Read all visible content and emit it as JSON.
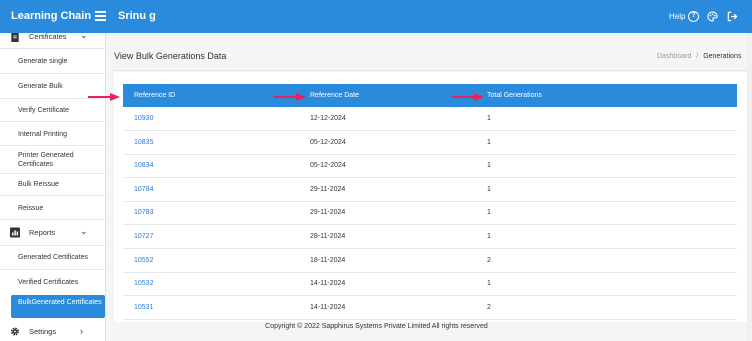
{
  "header": {
    "brand": "Learning Chain",
    "user_name": "Srinu g",
    "help_label": "Help",
    "color": "#2a8bdc"
  },
  "sidebar": {
    "sections": [
      {
        "label": "Certificates",
        "icon": "document-icon"
      },
      {
        "label": "Reports",
        "icon": "chart-icon"
      },
      {
        "label": "Settings",
        "icon": "gear-icon"
      }
    ],
    "certificate_items": [
      {
        "label": "Generate single"
      },
      {
        "label": "Generate Bulk"
      },
      {
        "label": "Verify Certificate"
      },
      {
        "label": "Internal Printing"
      },
      {
        "label": "Printer Generated Certificates"
      },
      {
        "label": "Bulk Reissue"
      },
      {
        "label": "Reissue"
      }
    ],
    "report_items": [
      {
        "label": "Generated Certificates"
      },
      {
        "label": "Verified Certificates"
      },
      {
        "label": "BulkGenerated Certificates"
      }
    ]
  },
  "main": {
    "title": "View Bulk Generations Data",
    "breadcrumb": {
      "home": "Dashboard",
      "separator": "/",
      "current": "Generations"
    },
    "table": {
      "columns": [
        "Reference ID",
        "Reference Date",
        "Total Generations"
      ],
      "rows": [
        {
          "id": "10930",
          "date": "12-12-2024",
          "total": "1"
        },
        {
          "id": "10835",
          "date": "05-12-2024",
          "total": "1"
        },
        {
          "id": "10834",
          "date": "05-12-2024",
          "total": "1"
        },
        {
          "id": "10784",
          "date": "29-11-2024",
          "total": "1"
        },
        {
          "id": "10783",
          "date": "29-11-2024",
          "total": "1"
        },
        {
          "id": "10727",
          "date": "28-11-2024",
          "total": "1"
        },
        {
          "id": "10552",
          "date": "18-11-2024",
          "total": "2"
        },
        {
          "id": "10532",
          "date": "14-11-2024",
          "total": "1"
        },
        {
          "id": "10531",
          "date": "14-11-2024",
          "total": "2"
        }
      ]
    }
  },
  "footer": {
    "copyright": "Copyright © 2022 Sapphirus Systems Private Limited All rights reserved"
  },
  "annotation_color": "#e8225a"
}
